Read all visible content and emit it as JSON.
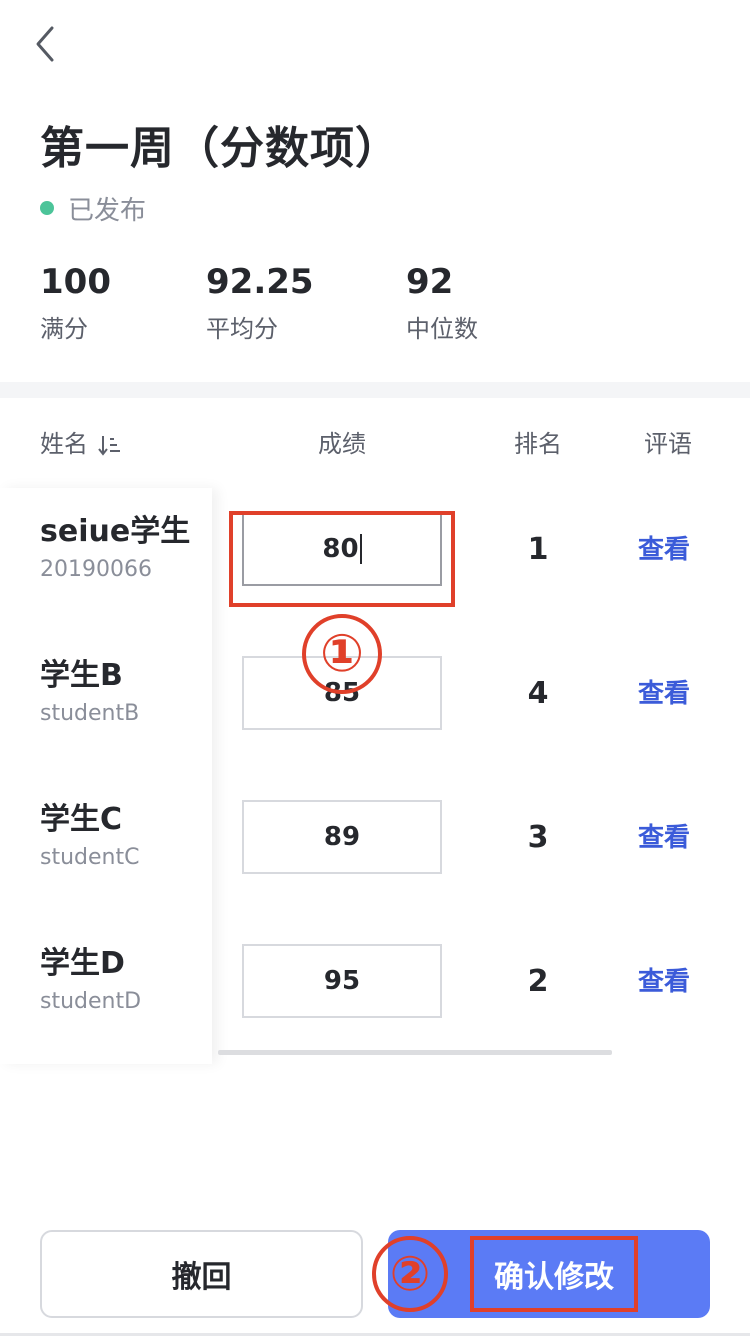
{
  "header": {
    "title": "第一周（分数项）",
    "status": "已发布",
    "status_color": "#4cc499"
  },
  "stats": [
    {
      "value": "100",
      "label": "满分"
    },
    {
      "value": "92.25",
      "label": "平均分"
    },
    {
      "value": "92",
      "label": "中位数"
    }
  ],
  "table": {
    "columns": {
      "name": "姓名",
      "score": "成绩",
      "rank": "排名",
      "comment": "评语"
    },
    "rows": [
      {
        "name": "seiue学生",
        "id": "20190066",
        "score": "80",
        "rank": "1",
        "comment": "查看"
      },
      {
        "name": "学生B",
        "id": "studentB",
        "score": "85",
        "rank": "4",
        "comment": "查看"
      },
      {
        "name": "学生C",
        "id": "studentC",
        "score": "89",
        "rank": "3",
        "comment": "查看"
      },
      {
        "name": "学生D",
        "id": "studentD",
        "score": "95",
        "rank": "2",
        "comment": "查看"
      }
    ]
  },
  "annotations": {
    "step1": "①",
    "step2": "②",
    "color": "#e0402a"
  },
  "actions": {
    "undo": "撤回",
    "confirm": "确认修改",
    "confirm_color": "#5b7bf5",
    "link_color": "#3b5bd9"
  }
}
